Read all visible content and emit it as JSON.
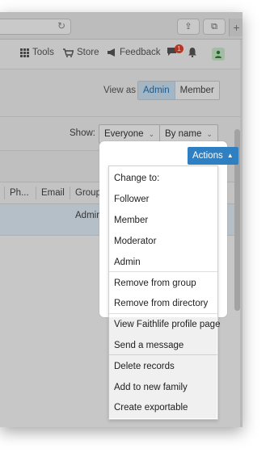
{
  "browser": {
    "reload_glyph": "↻",
    "share_glyph": "⇪",
    "tabs_glyph": "⧉",
    "new_tab_glyph": "+"
  },
  "nav": {
    "tools": "Tools",
    "store": "Store",
    "feedback": "Feedback",
    "notification_count": "1"
  },
  "view_as": {
    "label": "View as",
    "options": [
      "Admin",
      "Member"
    ],
    "selected": "Admin"
  },
  "filters": {
    "show_label": "Show:",
    "show_value": "Everyone",
    "sort_value": "By name"
  },
  "table": {
    "headers": [
      "Ph...",
      "Email",
      "Group St"
    ],
    "rows": [
      {
        "group_status": "Admin"
      }
    ]
  },
  "actions": {
    "button_label": "Actions",
    "menu": {
      "header": "Change to:",
      "change_items": [
        "Follower",
        "Member",
        "Moderator",
        "Admin"
      ],
      "group_items": [
        "Remove from group",
        "Remove from directory"
      ],
      "profile_items": [
        "View Faithlife profile page",
        "Send a message"
      ],
      "record_items": [
        "Delete records",
        "Add to new family",
        "Create exportable"
      ]
    }
  },
  "colors": {
    "accent": "#2f7fc3",
    "selected_row": "#dde9f3",
    "badge": "#e0432b"
  }
}
